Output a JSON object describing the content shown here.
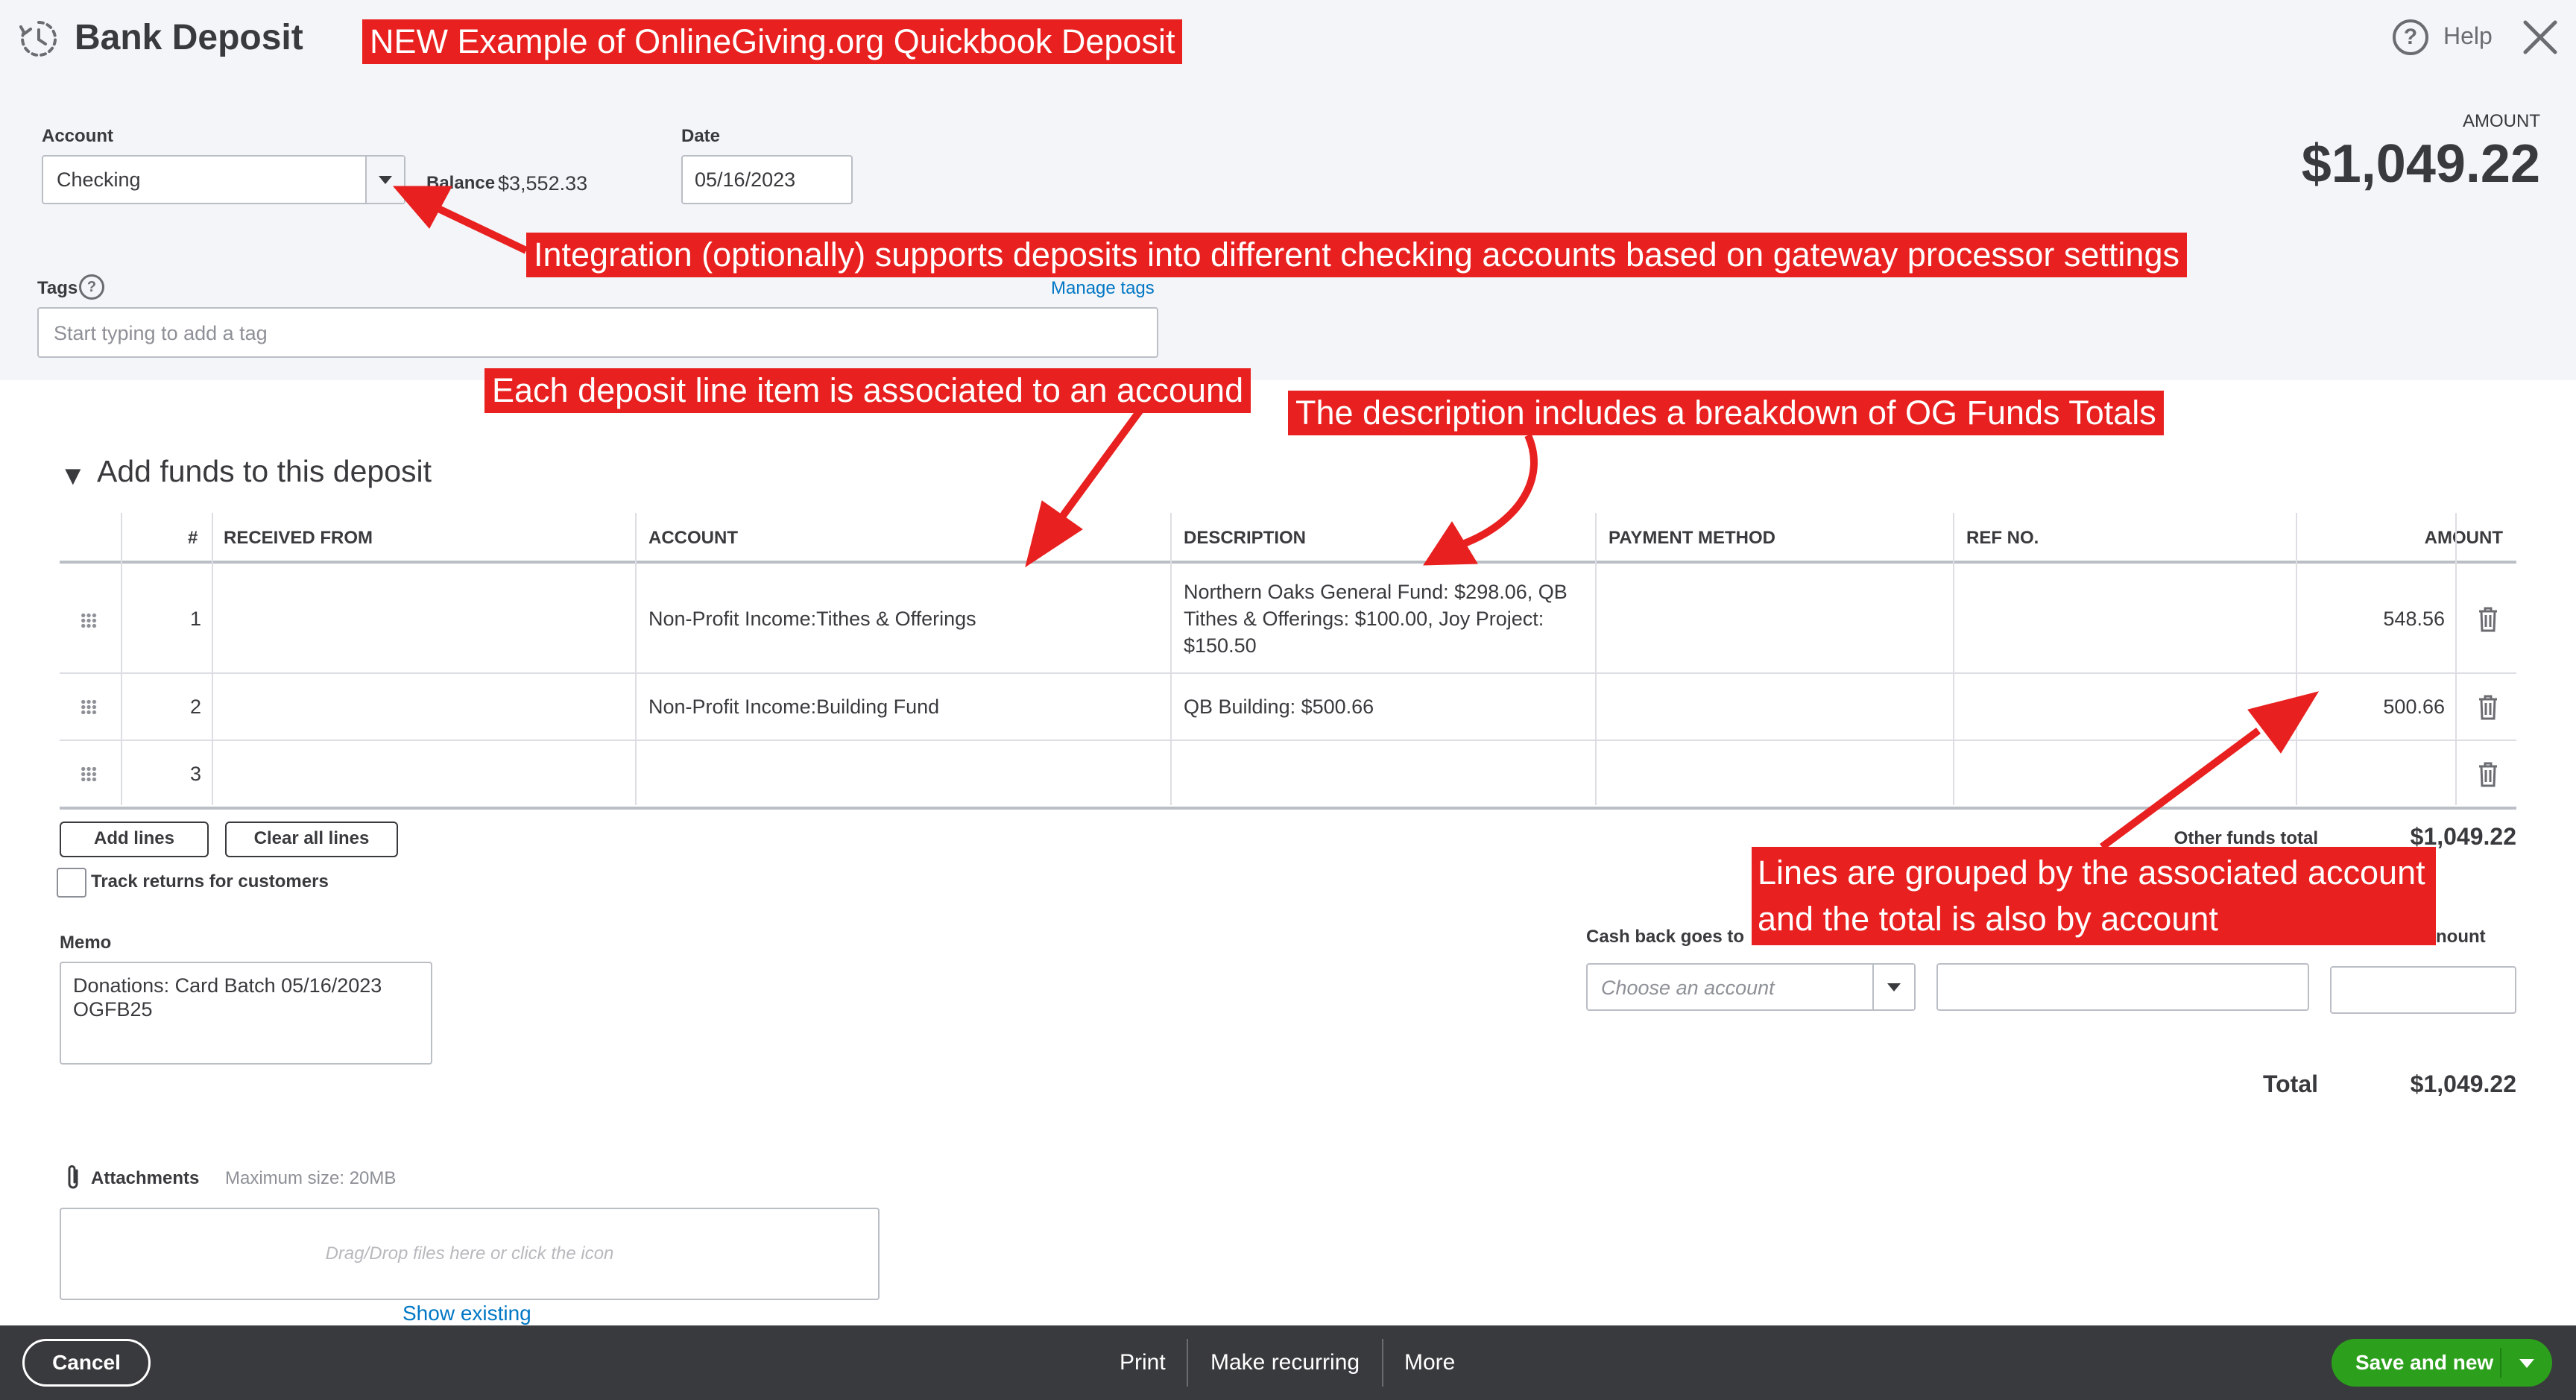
{
  "header": {
    "title": "Bank Deposit",
    "help_label": "Help"
  },
  "form": {
    "account_label": "Account",
    "account_value": "Checking",
    "balance_label": "Balance",
    "balance_value": "$3,552.33",
    "date_label": "Date",
    "date_value": "05/16/2023",
    "tags_label": "Tags",
    "tags_placeholder": "Start typing to add a tag",
    "manage_tags": "Manage tags",
    "amount_label": "AMOUNT",
    "amount_value": "$1,049.22"
  },
  "annotations": {
    "title_note": "NEW Example of OnlineGiving.org Quickbook Deposit",
    "integration_note": "Integration (optionally) supports deposits into different checking accounts based on gateway processor settings",
    "line_item_note": "Each deposit line item is associated to an accound",
    "description_note": "The description includes a breakdown of OG Funds Totals",
    "grouped_note_line1": "Lines are grouped by the associated account",
    "grouped_note_line2": "and the total is also by account"
  },
  "funds": {
    "section_title": "Add funds to this deposit",
    "columns": {
      "num": "#",
      "received_from": "RECEIVED FROM",
      "account": "ACCOUNT",
      "description": "DESCRIPTION",
      "payment_method": "PAYMENT METHOD",
      "ref_no": "REF NO.",
      "amount": "AMOUNT"
    },
    "rows": [
      {
        "num": "1",
        "received_from": "",
        "account": "Non-Profit Income:Tithes & Offerings",
        "description_lines": [
          "Northern Oaks General Fund: $298.06, QB",
          "Tithes & Offerings: $100.00, Joy Project:",
          "$150.50"
        ],
        "payment_method": "",
        "ref_no": "",
        "amount": "548.56"
      },
      {
        "num": "2",
        "received_from": "",
        "account": "Non-Profit Income:Building Fund",
        "description_lines": [
          "QB Building: $500.66"
        ],
        "payment_method": "",
        "ref_no": "",
        "amount": "500.66"
      },
      {
        "num": "3",
        "received_from": "",
        "account": "",
        "description_lines": [],
        "payment_method": "",
        "ref_no": "",
        "amount": ""
      }
    ],
    "add_lines": "Add lines",
    "clear_all_lines": "Clear all lines",
    "track_returns": "Track returns for customers",
    "other_funds_total_label": "Other funds total",
    "other_funds_total_value": "$1,049.22"
  },
  "memo": {
    "label": "Memo",
    "value": "Donations: Card Batch 05/16/2023\nOGFB25"
  },
  "cash_back": {
    "label": "Cash back goes to",
    "placeholder": "Choose an account",
    "amount_label_partial": "nount"
  },
  "total": {
    "label": "Total",
    "value": "$1,049.22"
  },
  "attachments": {
    "label": "Attachments",
    "max_size": "Maximum size: 20MB",
    "dropzone": "Drag/Drop files here or click the icon",
    "show_existing": "Show existing"
  },
  "footer": {
    "cancel": "Cancel",
    "print": "Print",
    "make_recurring": "Make recurring",
    "more": "More",
    "save_and_new": "Save and new"
  },
  "colors": {
    "annotation_red": "#e8201f",
    "save_green": "#2ca01c",
    "link_blue": "#0077c5",
    "footer_dark": "#393a3d"
  }
}
